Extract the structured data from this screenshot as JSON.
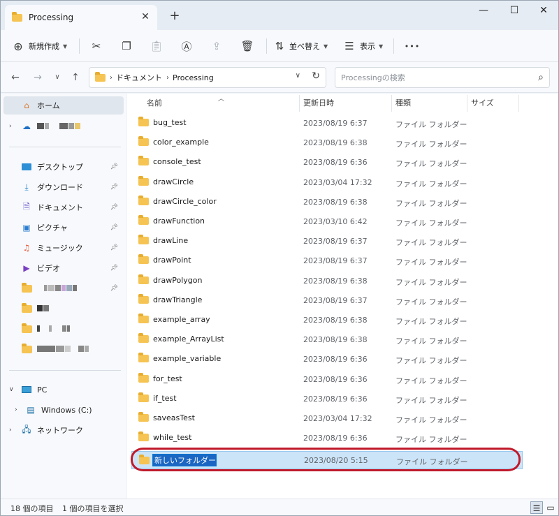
{
  "window": {
    "tab_title": "Processing",
    "tab_close": "✕",
    "new_tab": "+",
    "minimize": "—",
    "maximize": "☐",
    "close": "✕"
  },
  "toolbar": {
    "new_label": "新規作成",
    "sort_label": "並べ替え",
    "view_label": "表示",
    "more_label": "•••"
  },
  "address": {
    "crumbs": [
      "ドキュメント",
      "Processing"
    ],
    "search_placeholder": "Processingの検索"
  },
  "sidebar": {
    "home": "ホーム",
    "quick": [
      {
        "label": "デスクトップ",
        "icon": "desktop-icon",
        "color": "#2d8fd5"
      },
      {
        "label": "ダウンロード",
        "icon": "download-icon",
        "color": "#1f7fc6"
      },
      {
        "label": "ドキュメント",
        "icon": "document-icon",
        "color": "#6a5acd"
      },
      {
        "label": "ピクチャ",
        "icon": "pictures-icon",
        "color": "#2b7dd0"
      },
      {
        "label": "ミュージック",
        "icon": "music-icon",
        "color": "#e85a3a"
      },
      {
        "label": "ビデオ",
        "icon": "video-icon",
        "color": "#7b3fc4"
      }
    ],
    "pc": "PC",
    "windows_drive": "Windows (C:)",
    "network": "ネットワーク"
  },
  "columns": {
    "name": "名前",
    "date": "更新日時",
    "type": "種類",
    "size": "サイズ"
  },
  "files": [
    {
      "name": "bug_test",
      "date": "2023/08/19 6:37",
      "type": "ファイル フォルダー"
    },
    {
      "name": "color_example",
      "date": "2023/08/19 6:38",
      "type": "ファイル フォルダー"
    },
    {
      "name": "console_test",
      "date": "2023/08/19 6:36",
      "type": "ファイル フォルダー"
    },
    {
      "name": "drawCircle",
      "date": "2023/03/04 17:32",
      "type": "ファイル フォルダー"
    },
    {
      "name": "drawCircle_color",
      "date": "2023/08/19 6:38",
      "type": "ファイル フォルダー"
    },
    {
      "name": "drawFunction",
      "date": "2023/03/10 6:42",
      "type": "ファイル フォルダー"
    },
    {
      "name": "drawLine",
      "date": "2023/08/19 6:37",
      "type": "ファイル フォルダー"
    },
    {
      "name": "drawPoint",
      "date": "2023/08/19 6:37",
      "type": "ファイル フォルダー"
    },
    {
      "name": "drawPolygon",
      "date": "2023/08/19 6:38",
      "type": "ファイル フォルダー"
    },
    {
      "name": "drawTriangle",
      "date": "2023/08/19 6:37",
      "type": "ファイル フォルダー"
    },
    {
      "name": "example_array",
      "date": "2023/08/19 6:38",
      "type": "ファイル フォルダー"
    },
    {
      "name": "example_ArrayList",
      "date": "2023/08/19 6:38",
      "type": "ファイル フォルダー"
    },
    {
      "name": "example_variable",
      "date": "2023/08/19 6:36",
      "type": "ファイル フォルダー"
    },
    {
      "name": "for_test",
      "date": "2023/08/19 6:36",
      "type": "ファイル フォルダー"
    },
    {
      "name": "if_test",
      "date": "2023/08/19 6:36",
      "type": "ファイル フォルダー"
    },
    {
      "name": "saveasTest",
      "date": "2023/03/04 17:32",
      "type": "ファイル フォルダー"
    },
    {
      "name": "while_test",
      "date": "2023/08/19 6:36",
      "type": "ファイル フォルダー"
    }
  ],
  "new_folder": {
    "name": "新しいフォルダー",
    "date": "2023/08/20 5:15",
    "type": "ファイル フォルダー"
  },
  "status": {
    "count": "18 個の項目",
    "selected": "1 個の項目を選択"
  },
  "colors": {
    "accent": "#0078d4",
    "highlight_ring": "#c01a2b",
    "folder": "#f6c453"
  }
}
